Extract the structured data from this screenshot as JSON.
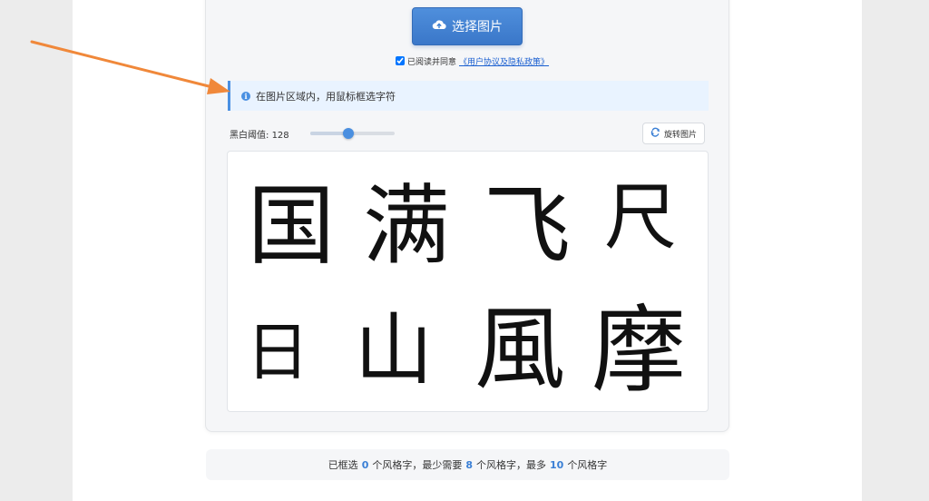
{
  "upload": {
    "select_label": "选择图片",
    "agree_checked": true,
    "agree_text": "已阅读并同意",
    "agree_link": "《用户协议及隐私政策》"
  },
  "info": {
    "text": "在图片区域内，用鼠标框选字符"
  },
  "controls": {
    "threshold_label": "黑白阈值:",
    "threshold_value": "128",
    "threshold_fraction": 0.45,
    "rotate_label": "旋转图片"
  },
  "canvas": {
    "characters": [
      "国",
      "满",
      "飞",
      "尺",
      "日",
      "山",
      "風",
      "摩"
    ]
  },
  "status": {
    "prefix": "已框选",
    "selected_count": "0",
    "part1": "个风格字，最少需要",
    "min_count": "8",
    "part2": "个风格字，最多",
    "max_count": "10",
    "part3": "个风格字"
  },
  "colors": {
    "accent": "#4a90e2",
    "annotation_arrow": "#f0883a"
  },
  "icons": {
    "upload": "cloud-upload-icon",
    "info": "info-circle-icon",
    "rotate": "refresh-icon",
    "arrow": "annotation-arrow"
  }
}
